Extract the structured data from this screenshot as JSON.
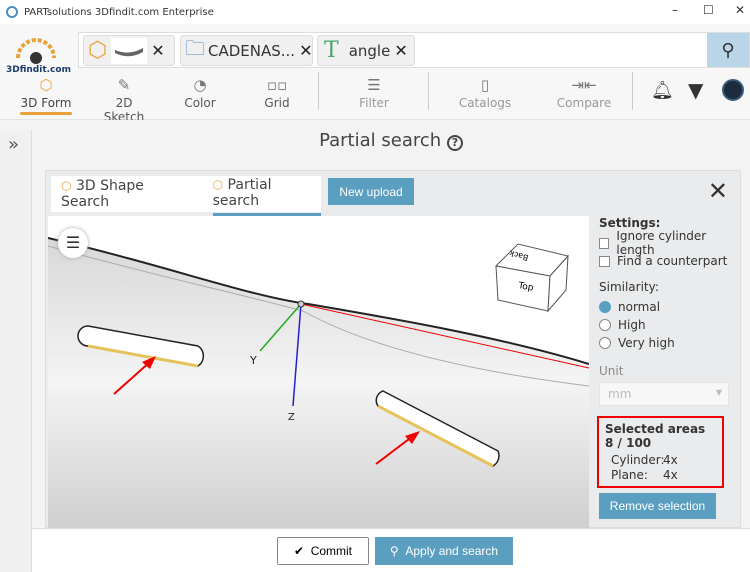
{
  "window": {
    "title": "PARTsolutions 3Dfindit.com Enterprise",
    "minimize": "–",
    "maximize": "☐",
    "close": "✕"
  },
  "logo": {
    "text": "3Dfindit.com"
  },
  "search": {
    "chips": [
      {
        "label": "",
        "icon": "cube-icon"
      },
      {
        "label": "CADENAS...",
        "icon": "folder-icon"
      },
      {
        "label": "angle",
        "icon": "text-icon"
      }
    ],
    "button_icon": "search-icon"
  },
  "nav": [
    {
      "label": "3D Form"
    },
    {
      "label": "2D Sketch"
    },
    {
      "label": "Color"
    },
    {
      "label": "Grid"
    },
    {
      "label": "Filter"
    },
    {
      "label": "Catalogs"
    },
    {
      "label": "Compare"
    }
  ],
  "page": {
    "title": "Partial search",
    "help": "?"
  },
  "tabs": [
    {
      "label": "3D Shape Search"
    },
    {
      "label": "Partial search"
    }
  ],
  "new_upload": "New upload",
  "viewcube": {
    "top": "Top",
    "back": "Back"
  },
  "axes": {
    "y": "Y",
    "z": "Z"
  },
  "settings": {
    "heading": "Settings:",
    "ignore_cyl": "Ignore cylinder length",
    "counterpart": "Find a counterpart",
    "similarity": "Similarity:",
    "options": [
      "normal",
      "High",
      "Very high"
    ],
    "selected": "normal",
    "unit_label": "Unit",
    "unit_value": "mm"
  },
  "selection": {
    "title": "Selected areas 8 / 100",
    "cyl_label": "Cylinder:",
    "cyl_val": "4x",
    "plane_label": "Plane:",
    "plane_val": "4x"
  },
  "remove": "Remove selection",
  "footer": {
    "commit": "Commit",
    "apply": "Apply and search"
  },
  "colors": {
    "accent": "#5a9ec0",
    "highlight": "#e00000"
  }
}
